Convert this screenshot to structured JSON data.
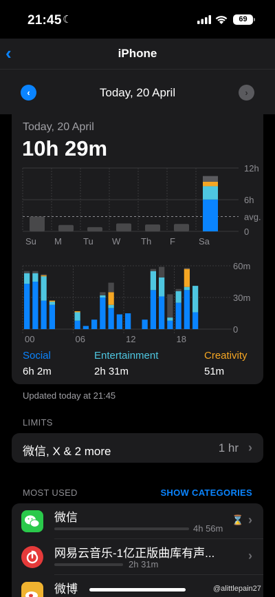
{
  "status_bar": {
    "time": "21:45",
    "battery": "69",
    "icons": [
      "moon-icon",
      "signal-icon",
      "wifi-icon",
      "battery-icon"
    ]
  },
  "nav": {
    "back_icon": "chevron-left-icon",
    "title": "iPhone"
  },
  "date_bar": {
    "label": "Today, 20 April",
    "prev_icon": "chevron-left-circle-icon",
    "next_icon": "chevron-right-circle-icon"
  },
  "summary": {
    "subtitle": "Today, 20 April",
    "total": "10h 29m"
  },
  "colors": {
    "social": "#0a84ff",
    "entertainment": "#4ec6e0",
    "creativity": "#f5a623",
    "other": "#48484a",
    "accent": "#0a84ff"
  },
  "weekly_chart": {
    "days": [
      "Su",
      "M",
      "Tu",
      "W",
      "Th",
      "F",
      "Sa"
    ],
    "y_labels": [
      "12h",
      "6h",
      "0"
    ],
    "avg_label": "avg.",
    "ymax_hours": 12,
    "avg_hours": 2.8,
    "values_hours": [
      2.8,
      1.2,
      0.8,
      1.5,
      1.3,
      1.4,
      10.5
    ],
    "today_breakdown_hours": {
      "social": 6.03,
      "entertainment": 2.52,
      "creativity": 0.85,
      "other": 1.08
    }
  },
  "hourly_chart": {
    "x_labels": [
      "00",
      "06",
      "12",
      "18"
    ],
    "y_labels": [
      "60m",
      "30m",
      "0"
    ],
    "ymax_minutes": 60,
    "hours": [
      {
        "h": 0,
        "social": 43,
        "entertainment": 10,
        "creativity": 0,
        "other": 2
      },
      {
        "h": 1,
        "social": 45,
        "entertainment": 8,
        "creativity": 0,
        "other": 2
      },
      {
        "h": 2,
        "social": 27,
        "entertainment": 23,
        "creativity": 1,
        "other": 1
      },
      {
        "h": 3,
        "social": 23,
        "entertainment": 3,
        "creativity": 1,
        "other": 0
      },
      {
        "h": 6,
        "social": 8,
        "entertainment": 8,
        "creativity": 1,
        "other": 0
      },
      {
        "h": 7,
        "social": 3,
        "entertainment": 0,
        "creativity": 0,
        "other": 0
      },
      {
        "h": 8,
        "social": 9,
        "entertainment": 0,
        "creativity": 0,
        "other": 0
      },
      {
        "h": 9,
        "social": 30,
        "entertainment": 2,
        "creativity": 0,
        "other": 3
      },
      {
        "h": 10,
        "social": 20,
        "entertainment": 3,
        "creativity": 12,
        "other": 9
      },
      {
        "h": 11,
        "social": 14,
        "entertainment": 0,
        "creativity": 0,
        "other": 0
      },
      {
        "h": 12,
        "social": 15,
        "entertainment": 0,
        "creativity": 0,
        "other": 0
      },
      {
        "h": 14,
        "social": 9,
        "entertainment": 0,
        "creativity": 0,
        "other": 0
      },
      {
        "h": 15,
        "social": 37,
        "entertainment": 18,
        "creativity": 0,
        "other": 2
      },
      {
        "h": 16,
        "social": 31,
        "entertainment": 18,
        "creativity": 0,
        "other": 10
      },
      {
        "h": 17,
        "social": 8,
        "entertainment": 3,
        "creativity": 0,
        "other": 22
      },
      {
        "h": 18,
        "social": 25,
        "entertainment": 11,
        "creativity": 0,
        "other": 2
      },
      {
        "h": 19,
        "social": 37,
        "entertainment": 3,
        "creativity": 17,
        "other": 1
      },
      {
        "h": 20,
        "social": 16,
        "entertainment": 25,
        "creativity": 0,
        "other": 0
      }
    ]
  },
  "categories": [
    {
      "name": "Social",
      "value": "6h 2m"
    },
    {
      "name": "Entertainment",
      "value": "2h 31m"
    },
    {
      "name": "Creativity",
      "value": "51m"
    }
  ],
  "updated": "Updated today at 21:45",
  "limits": {
    "section": "LIMITS",
    "row_text": "微信, X & 2 more",
    "row_value": "1 hr"
  },
  "most_used": {
    "section": "MOST USED",
    "show_categories": "SHOW CATEGORIES",
    "apps": [
      {
        "name": "微信",
        "time": "4h 56m",
        "usage_fraction": 1.0,
        "icon": "wechat-icon",
        "icon_color": "#2ac94b",
        "limit_icon": "hourglass-icon"
      },
      {
        "name": "网易云音乐-1亿正版曲库有声...",
        "time": "2h 31m",
        "usage_fraction": 0.51,
        "icon": "netease-music-icon",
        "icon_color": "#e53a3a"
      },
      {
        "name": "微博",
        "time": "",
        "usage_fraction": 0.3,
        "icon": "weibo-icon",
        "icon_color": "#f0b330"
      }
    ]
  },
  "watermark": "@alittlepain27"
}
